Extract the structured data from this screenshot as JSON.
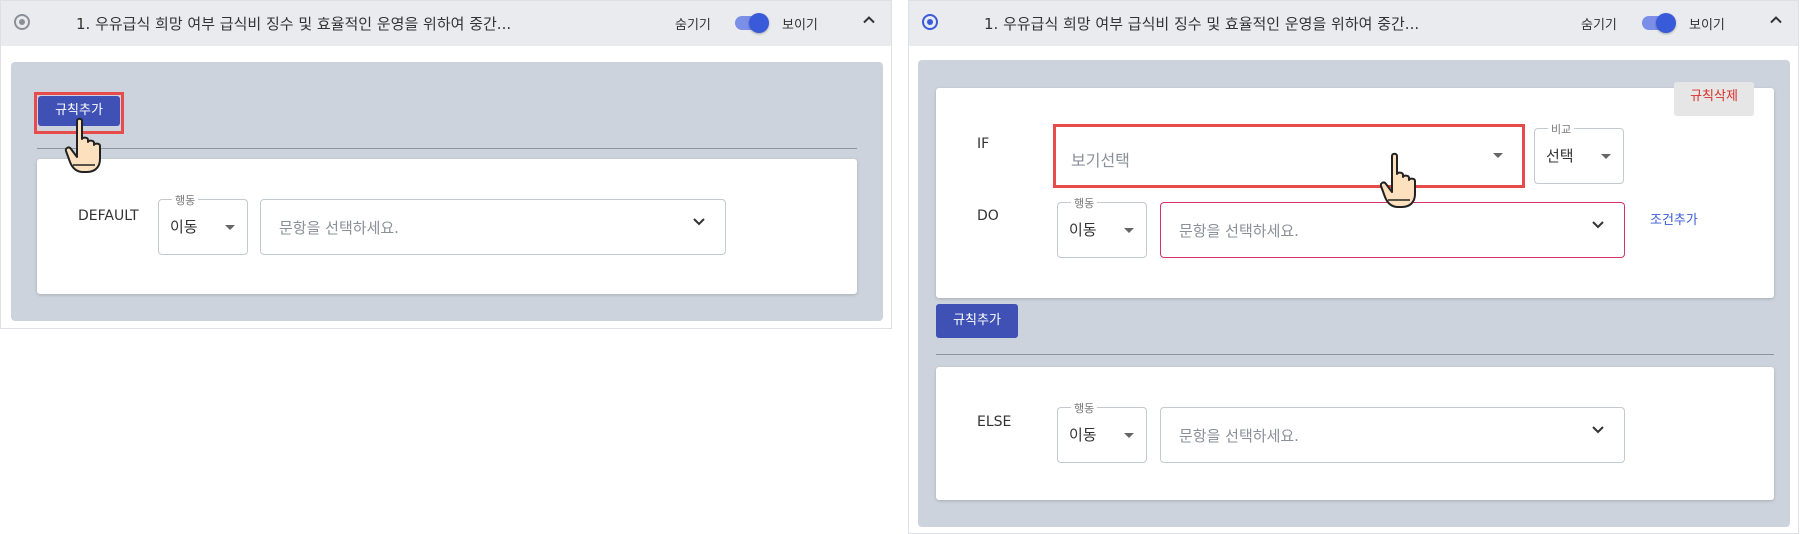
{
  "left_panel": {
    "question_title": "1. 우유급식 희망 여부 급식비 징수 및 효율적인 운영을 위하여 중간...",
    "hide_label": "숨기기",
    "show_label": "보이기",
    "add_rule_label": "규칙추가",
    "default_label": "DEFAULT",
    "action_legend": "행동",
    "action_value": "이동",
    "question_placeholder": "문항을 선택하세요."
  },
  "right_panel": {
    "question_title": "1. 우유급식 희망 여부 급식비 징수 및 효율적인 운영을 위하여 중간...",
    "hide_label": "숨기기",
    "show_label": "보이기",
    "delete_rule_label": "규칙삭제",
    "if_label": "IF",
    "option_select_placeholder": "보기선택",
    "compare_legend": "비교",
    "compare_value": "선택",
    "do_label": "DO",
    "action_legend": "행동",
    "action_value": "이동",
    "question_placeholder": "문항을 선택하세요.",
    "add_condition_label": "조건추가",
    "add_rule_label": "규칙추가",
    "else_label": "ELSE",
    "else_action_legend": "행동",
    "else_action_value": "이동",
    "else_question_placeholder": "문항을 선택하세요."
  },
  "icons": {
    "radio": "radio-icon",
    "collapse": "chevron-up-icon",
    "dropdown": "chevron-down-icon",
    "pointer": "hand-pointer-icon"
  },
  "colors": {
    "accent": "#3f51b5",
    "toggle": "#3a5bd9",
    "highlight": "#e84b4b",
    "delete_text": "#d9302c",
    "panel_bg": "#cdd3dc"
  }
}
